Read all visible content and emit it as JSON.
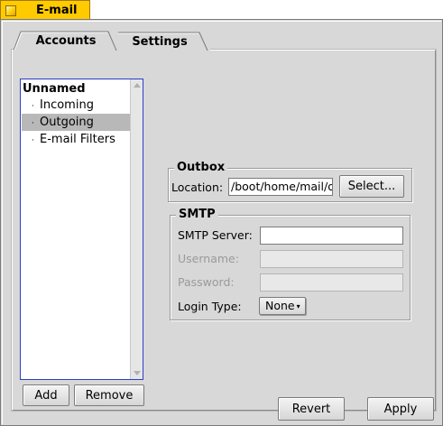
{
  "window": {
    "title": "E-mail"
  },
  "tabs": [
    {
      "label": "Accounts",
      "active": true
    },
    {
      "label": "Settings",
      "active": false
    }
  ],
  "accounts_tree": {
    "account_name": "Unnamed",
    "children": [
      {
        "label": "Incoming",
        "selected": false
      },
      {
        "label": "Outgoing",
        "selected": true
      },
      {
        "label": "E-mail Filters",
        "selected": false
      }
    ],
    "bullet": "·"
  },
  "list_buttons": {
    "add": "Add",
    "remove": "Remove"
  },
  "outbox": {
    "title": "Outbox",
    "location_label": "Location:",
    "location_value": "/boot/home/mail/o",
    "select_button": "Select..."
  },
  "smtp": {
    "title": "SMTP",
    "server_label": "SMTP Server:",
    "server_value": "",
    "username_label": "Username:",
    "username_value": "",
    "password_label": "Password:",
    "password_value": "",
    "login_type_label": "Login Type:",
    "login_type_value": "None",
    "login_type_caret": "▾"
  },
  "footer": {
    "revert": "Revert",
    "apply": "Apply"
  },
  "colors": {
    "window_tab": "#ffcb00",
    "panel_bg": "#d8d8d8",
    "list_focus_border": "#2f3ec4",
    "selected_row": "#b8b8b8"
  }
}
